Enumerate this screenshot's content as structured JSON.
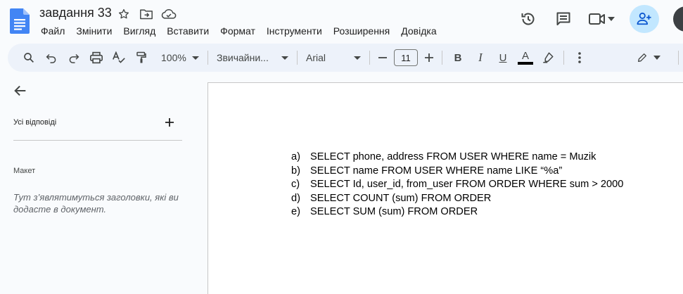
{
  "doc": {
    "title": "завдання 33"
  },
  "menu": [
    "Файл",
    "Змінити",
    "Вигляд",
    "Вставити",
    "Формат",
    "Інструменти",
    "Розширення",
    "Довідка"
  ],
  "toolbar": {
    "zoom": "100%",
    "style": "Звичайни...",
    "font": "Arial",
    "font_size": "11",
    "text_color_glyph": "A",
    "bold_glyph": "B",
    "italic_glyph": "I",
    "underline_glyph": "U",
    "text_color_bar": "#000000"
  },
  "sidebar": {
    "tabs_heading": "Усі відповіді",
    "outline_heading": "Макет",
    "outline_hint": "Тут з’являтимуться заголовки, які ви додасте в документ."
  },
  "document": {
    "items": [
      {
        "label": "a)",
        "text": "SELECT phone, address FROM USER WHERE name = Muzik"
      },
      {
        "label": "b)",
        "text": "SELECT name FROM USER WHERE name LIKE “%a”"
      },
      {
        "label": "c)",
        "text": "SELECT Id, user_id, from_user FROM ORDER WHERE sum > 2000"
      },
      {
        "label": "d)",
        "text": "SELECT COUNT (sum) FROM ORDER"
      },
      {
        "label": "e)",
        "text": "SELECT SUM (sum) FROM ORDER"
      }
    ]
  },
  "colors": {
    "accent": "#0b57d0",
    "share_bg": "#c2e7ff",
    "toolbar_bg": "#edf2fa"
  }
}
